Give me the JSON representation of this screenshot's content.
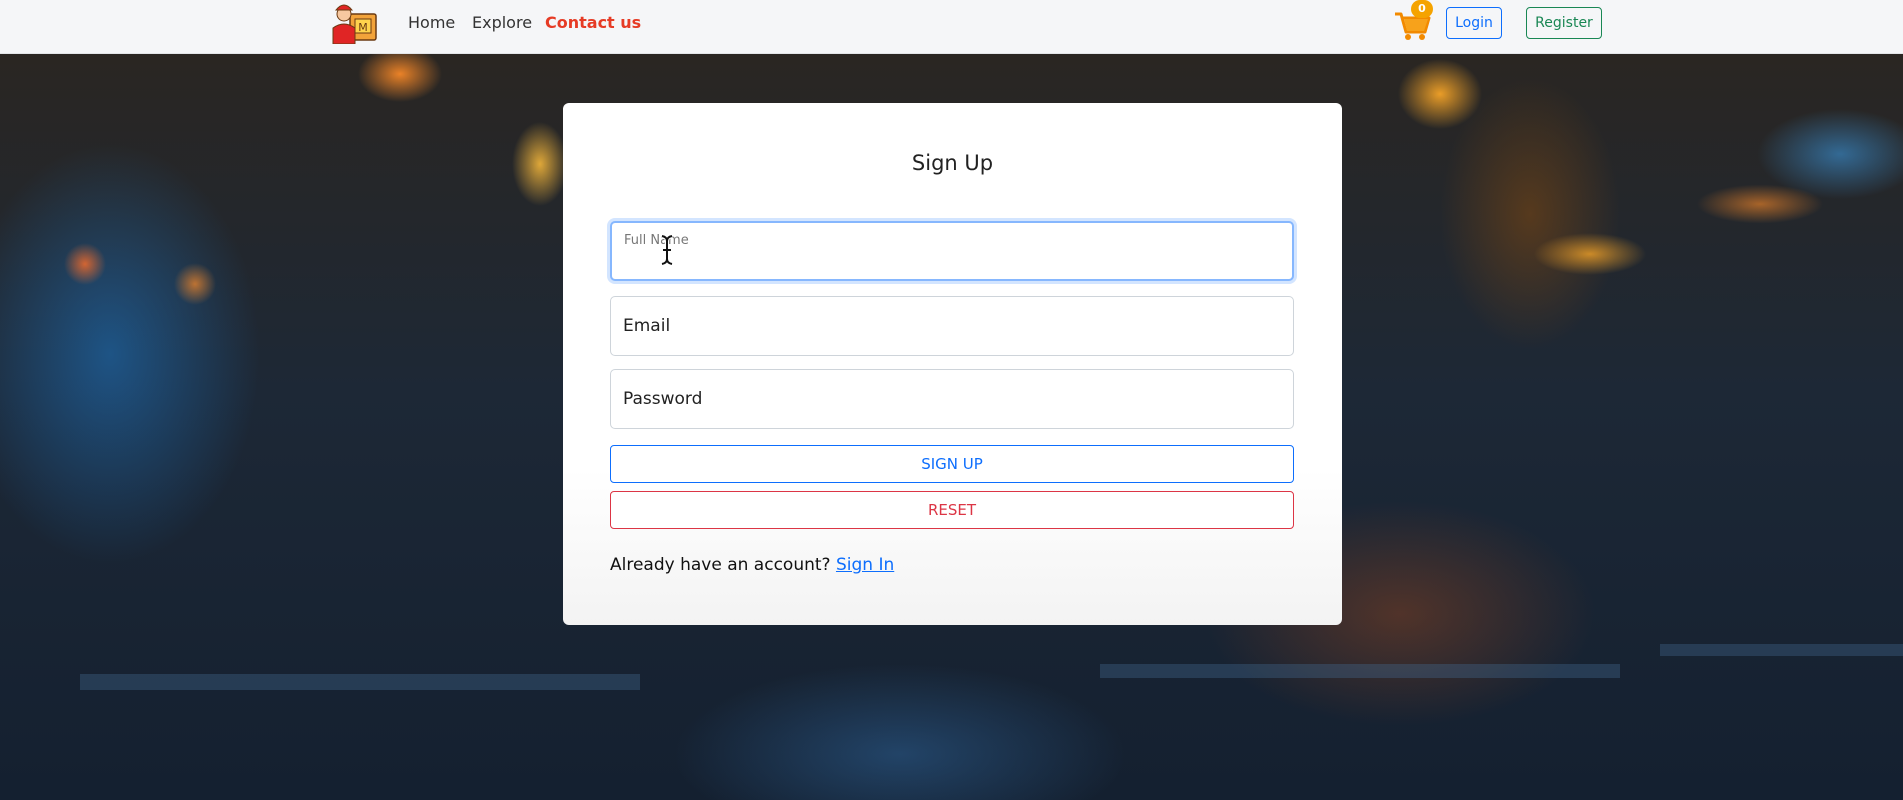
{
  "nav": {
    "links": [
      "Home",
      "Explore",
      "Contact us"
    ],
    "cart_count": "0",
    "login_label": "Login",
    "register_label": "Register"
  },
  "form": {
    "title": "Sign Up",
    "fullname_label": "Full Name",
    "email_label": "Email",
    "password_label": "Password",
    "signup_label": "SIGN UP",
    "reset_label": "RESET",
    "footer_text": "Already have an account?",
    "signin_link": "Sign In"
  },
  "colors": {
    "contact_accent": "#e63b25",
    "primary": "#0d6efd",
    "success": "#198754",
    "danger": "#dc3545",
    "badge": "#f5a300"
  },
  "icons": [
    "delivery-logo-icon",
    "cart-icon",
    "text-cursor-icon"
  ]
}
